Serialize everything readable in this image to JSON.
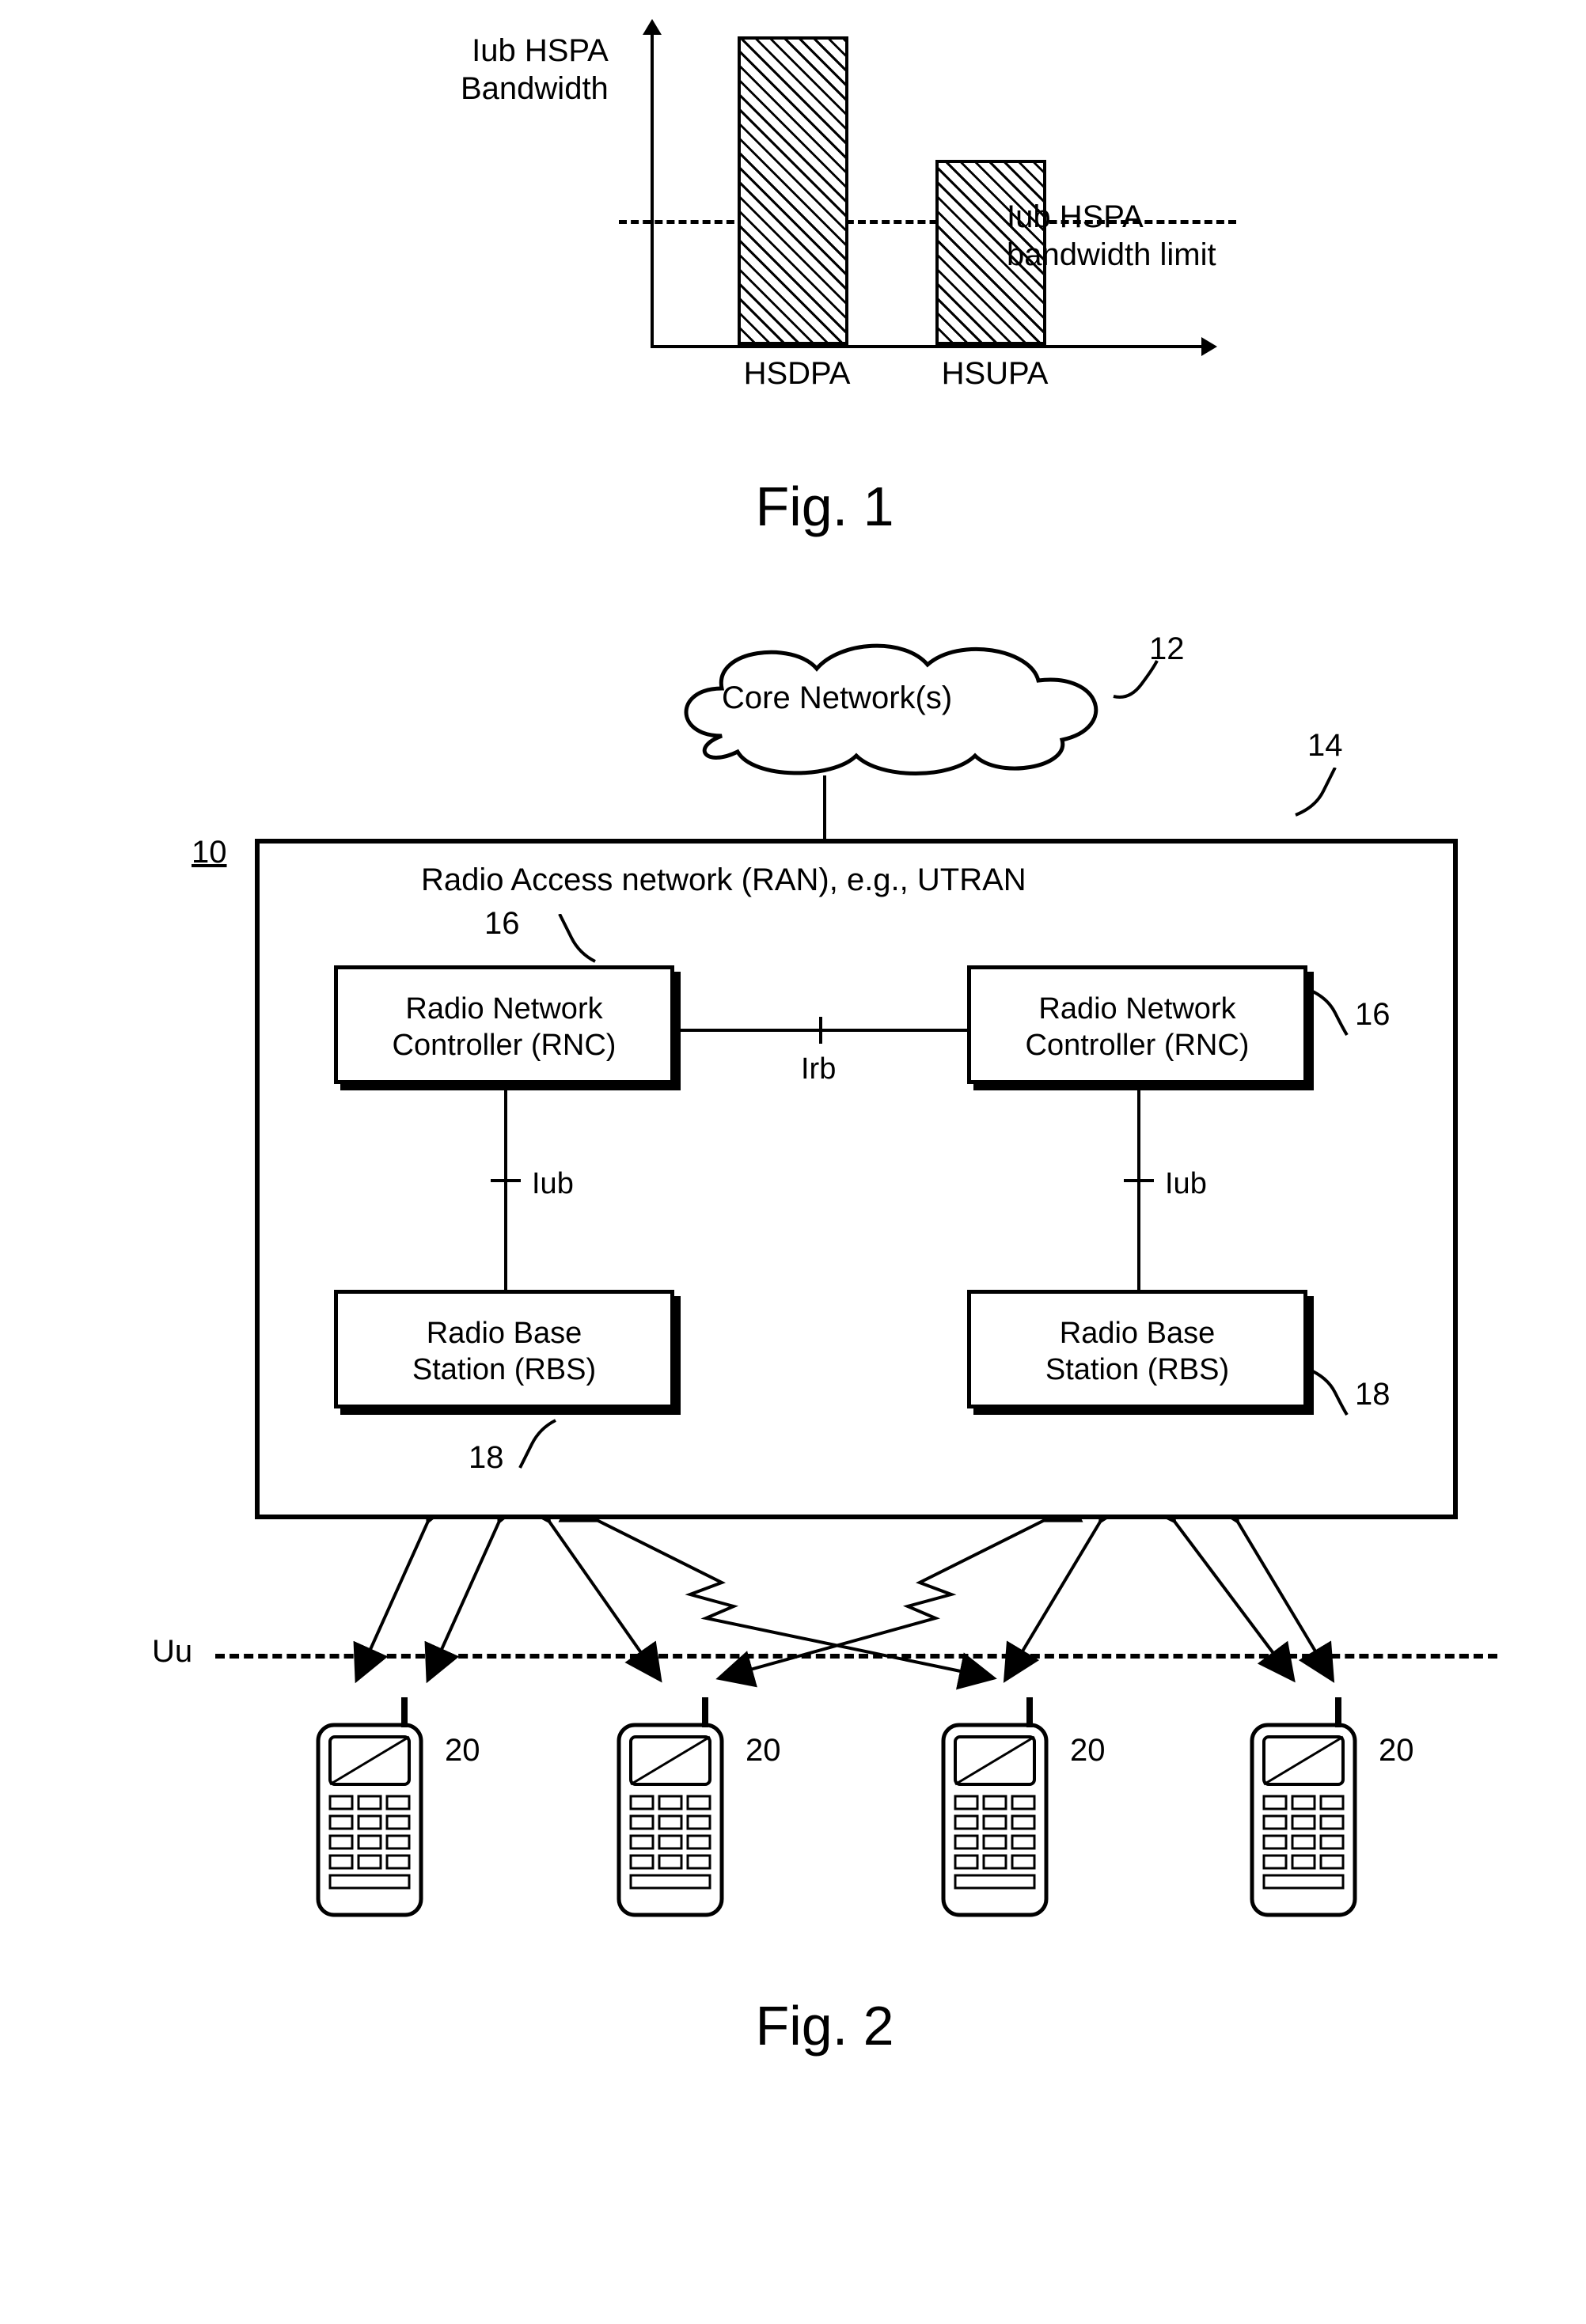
{
  "chart_data": {
    "type": "bar",
    "categories": [
      "HSDPA",
      "HSUPA"
    ],
    "values": [
      100,
      60
    ],
    "title": "",
    "xlabel": "",
    "ylabel": "Iub HSPA Bandwidth",
    "reference_line_value": 40,
    "reference_line_label": "Iub HSPA bandwidth limit",
    "ylim": [
      0,
      110
    ]
  },
  "figures": {
    "fig1_caption": "Fig. 1",
    "fig2_caption": "Fig. 2"
  },
  "fig2": {
    "cloud": "Core Network(s)",
    "ref12": "12",
    "ref14": "14",
    "ref10": "10",
    "ran_title": "Radio Access network (RAN), e.g., UTRAN",
    "rnc_label": "Radio Network Controller (RNC)",
    "rbs_label": "Radio Base Station (RBS)",
    "ref16": "16",
    "ref18": "18",
    "iub": "Iub",
    "irb": "Irb",
    "uu": "Uu",
    "ref20": "20"
  }
}
